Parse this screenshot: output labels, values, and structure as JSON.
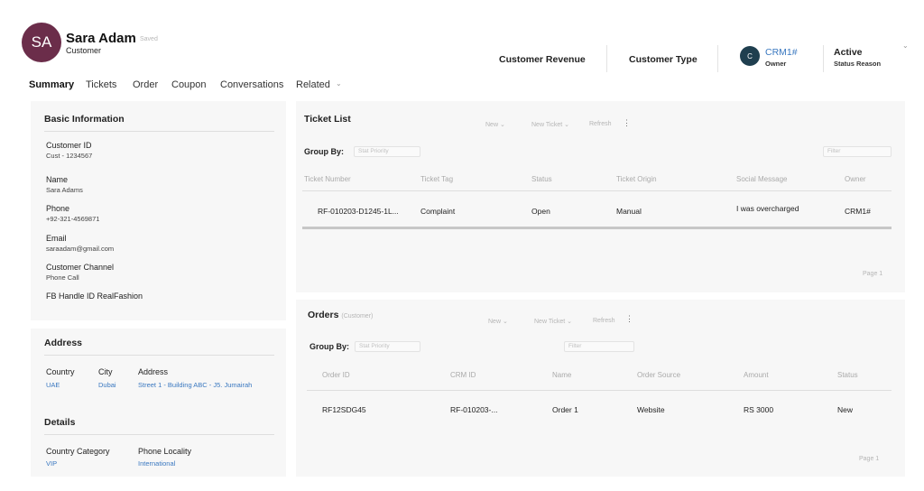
{
  "profile": {
    "initials": "SA",
    "name": "Sara Adam",
    "saved": "Saved",
    "type": "Customer"
  },
  "header_fields": {
    "revenue": "Customer Revenue",
    "type": "Customer Type",
    "owner_initial": "C",
    "owner_name": "CRM1#",
    "owner_label": "Owner",
    "status_value": "Active",
    "status_label": "Status Reason"
  },
  "tabs": [
    "Summary",
    "Tickets",
    "Order",
    "Coupon",
    "Conversations",
    "Related"
  ],
  "basic_info": {
    "title": "Basic Information",
    "fields": [
      {
        "label": "Customer ID",
        "value": "Cust - 1234567"
      },
      {
        "label": "Name",
        "value": "Sara Adams"
      },
      {
        "label": "Phone",
        "value": "+92-321-4569871"
      },
      {
        "label": "Email",
        "value": "saraadam@gmail.com"
      },
      {
        "label": "Customer Channel",
        "value": "Phone Call"
      },
      {
        "label": "FB Handle ID RealFashion",
        "value": ""
      }
    ]
  },
  "address": {
    "title": "Address",
    "labels": [
      "Country",
      "City",
      "Address"
    ],
    "values": [
      "UAE",
      "Dubai",
      "Street 1 - Building ABC - J5. Jumairah"
    ]
  },
  "details": {
    "title": "Details",
    "labels": [
      "Country Category",
      "Phone Locality"
    ],
    "values": [
      "VIP",
      "International"
    ]
  },
  "ticket_list": {
    "title": "Ticket List",
    "actions": [
      "New",
      "New Ticket",
      "Refresh"
    ],
    "group_by_label": "Group By:",
    "group_by_value": "Stat Priority",
    "filter_placeholder": "Filter",
    "columns": [
      "Ticket Number",
      "Ticket Tag",
      "Status",
      "Ticket Origin",
      "Social Message",
      "Owner"
    ],
    "rows": [
      [
        "RF-010203-D1245-1L...",
        "Complaint",
        "Open",
        "Manual",
        "I was overcharged",
        "CRM1#"
      ]
    ],
    "page": "Page 1"
  },
  "orders": {
    "title": "Orders",
    "subtitle": "(Customer)",
    "actions": [
      "New",
      "New Ticket",
      "Refresh"
    ],
    "group_by_label": "Group By:",
    "group_by_value": "Stat Priority",
    "filter_placeholder": "Filter",
    "columns": [
      "Order ID",
      "CRM ID",
      "Name",
      "Order Source",
      "Amount",
      "Status"
    ],
    "rows": [
      [
        "RF12SDG45",
        "RF-010203-...",
        "Order 1",
        "Website",
        "RS 3000",
        "New"
      ]
    ],
    "page": "Page 1"
  }
}
